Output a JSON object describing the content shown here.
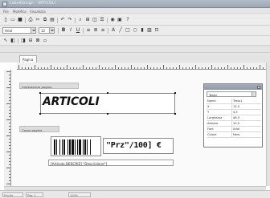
{
  "window": {
    "title": "LabelDesign - ARTICOLI"
  },
  "menu": [
    "File",
    "Modifica",
    "Visualizza"
  ],
  "toolbar": {
    "font_combo_value": "Arial",
    "size_combo_value": "12"
  },
  "tabs": [
    {
      "label": "Pagina 1"
    }
  ],
  "sections": {
    "header_label": "Intestazione pagina",
    "body_label": "Corpo pagina"
  },
  "label_fields": {
    "title_text": "ARTICOLI",
    "price_text": "\"Prz\"/100] €",
    "data_text": "[Articolo.DESCRIZ] \"Descrizione\"]"
  },
  "properties": {
    "dropdown_value": "Testo",
    "rows": [
      {
        "key": "Nome",
        "value": "Testo1"
      },
      {
        "key": "X",
        "value": "12,0"
      },
      {
        "key": "Y",
        "value": "4,5"
      },
      {
        "key": "Larghezza",
        "value": "48,0"
      },
      {
        "key": "Altezza",
        "value": "10,0"
      },
      {
        "key": "Font",
        "value": "Arial"
      },
      {
        "key": "Colore",
        "value": "Nero"
      }
    ]
  },
  "status": [
    "Pronto",
    "Pag. 1",
    "100%"
  ],
  "colors": {
    "title_bar": "#9aa6b3",
    "canvas": "#fafafa",
    "section_bar": "#dcdcdc"
  },
  "icons": [
    "new-icon",
    "open-icon",
    "save-icon",
    "print-icon",
    "cut-icon",
    "copy-icon",
    "paste-icon",
    "undo-icon",
    "redo-icon",
    "bold-icon",
    "italic-icon",
    "underline-icon",
    "align-left-icon",
    "align-center-icon",
    "align-right-icon",
    "barcode-icon",
    "image-icon",
    "zoom-icon"
  ]
}
